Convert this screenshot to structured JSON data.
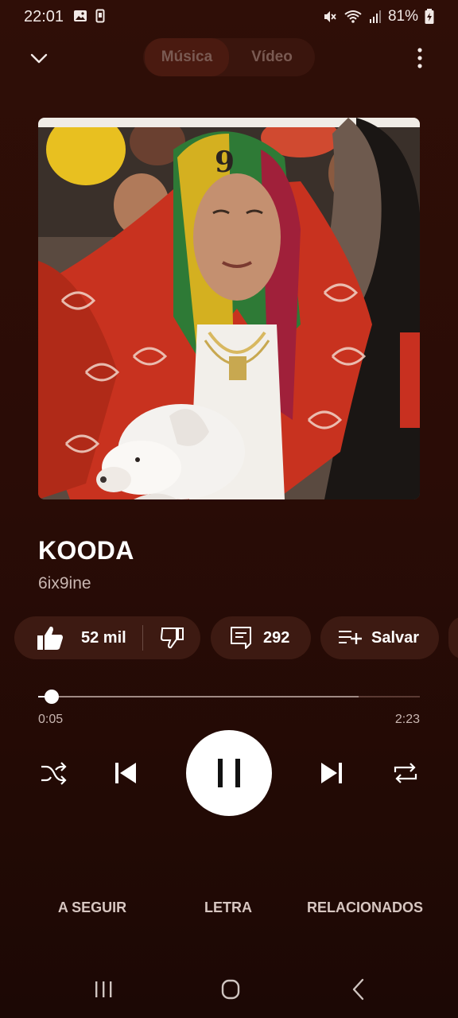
{
  "status_bar": {
    "time": "22:01",
    "battery": "81%",
    "icons": [
      "image-icon",
      "device-icon",
      "mute-icon",
      "wifi-icon",
      "signal-icon",
      "battery-charging-icon"
    ]
  },
  "top_bar": {
    "collapse_icon": "chevron-down-icon",
    "tabs": [
      {
        "label": "Música",
        "selected": true
      },
      {
        "label": "Vídeo",
        "selected": false
      }
    ],
    "more_icon": "more-vertical-icon"
  },
  "track": {
    "title": "KOODA",
    "artist": "6ix9ine"
  },
  "actions": {
    "likes": "52 mil",
    "comments": "292",
    "save_label": "Salvar"
  },
  "progress": {
    "current": "0:05",
    "duration": "2:23",
    "played_fraction": 0.035,
    "buffered_fraction": 0.84
  },
  "controls": {
    "shuffle_icon": "shuffle-icon",
    "previous_icon": "skip-previous-icon",
    "pause_icon": "pause-icon",
    "next_icon": "skip-next-icon",
    "repeat_icon": "repeat-icon"
  },
  "bottom_tabs": [
    "A SEGUIR",
    "LETRA",
    "RELACIONADOS"
  ],
  "colors": {
    "background": "#2a0c06",
    "chip": "#3d1a12",
    "accent_red": "#c8321f"
  }
}
